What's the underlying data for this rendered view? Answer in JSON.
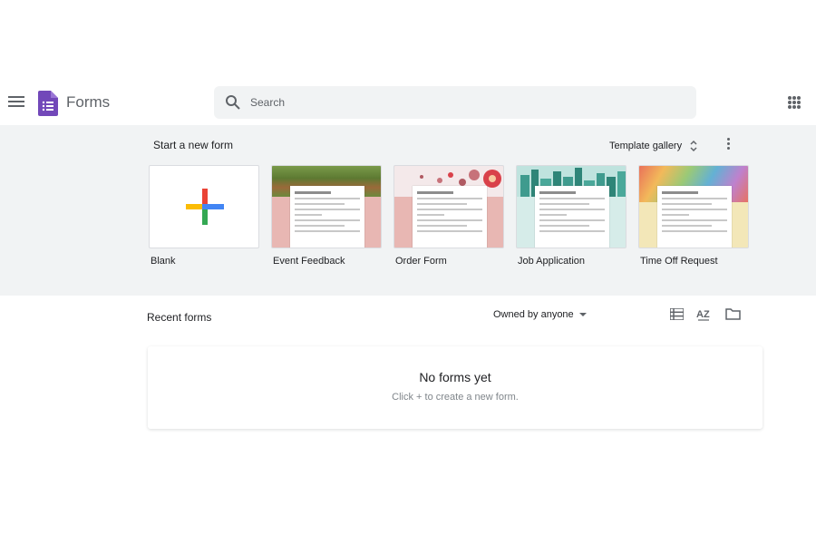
{
  "header": {
    "app_name": "Forms",
    "search_placeholder": "Search"
  },
  "templates": {
    "title": "Start a new form",
    "gallery_label": "Template gallery",
    "items": [
      {
        "label": "Blank"
      },
      {
        "label": "Event Feedback"
      },
      {
        "label": "Order Form"
      },
      {
        "label": "Job Application"
      },
      {
        "label": "Time Off Request"
      }
    ]
  },
  "recent": {
    "title": "Recent forms",
    "owner_filter": "Owned by anyone",
    "sort_label": "AZ",
    "empty_title": "No forms yet",
    "empty_subtitle": "Click + to create a new form."
  },
  "colors": {
    "forms_purple": "#7248b9",
    "band_background": "#f1f3f4",
    "plus_red": "#ea4335",
    "plus_blue": "#4285f4",
    "plus_yellow": "#fbbc04",
    "plus_green": "#34a853"
  },
  "icons": [
    "menu-icon",
    "forms-logo-icon",
    "search-icon",
    "apps-grid-icon",
    "unfold-icon",
    "more-vert-icon",
    "plus-icon",
    "list-view-icon",
    "sort-az-icon",
    "folder-icon",
    "dropdown-caret-icon"
  ]
}
